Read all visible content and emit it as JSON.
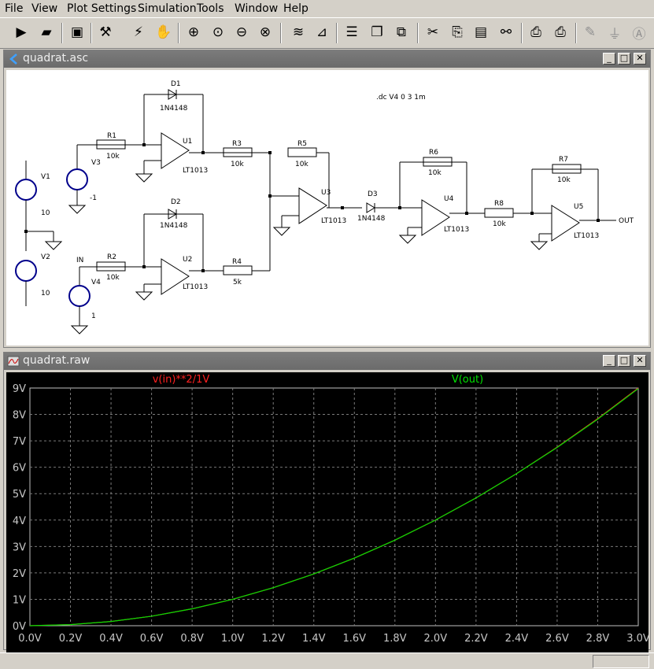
{
  "menu": {
    "file": "File",
    "view": "View",
    "plot_settings": "Plot Settings",
    "simulation": "Simulation",
    "tools": "Tools",
    "window": "Window",
    "help": "Help"
  },
  "schematic_window": {
    "title": "quadrat.asc",
    "directive": ".dc V4 0 3 1m",
    "components": {
      "D1": {
        "name": "D1",
        "model": "1N4148"
      },
      "D2": {
        "name": "D2",
        "model": "1N4148"
      },
      "D3": {
        "name": "D3",
        "model": "1N4148"
      },
      "R1": {
        "name": "R1",
        "value": "10k"
      },
      "R2": {
        "name": "R2",
        "value": "10k"
      },
      "R3": {
        "name": "R3",
        "value": "10k"
      },
      "R4": {
        "name": "R4",
        "value": "5k"
      },
      "R5": {
        "name": "R5",
        "value": "10k"
      },
      "R6": {
        "name": "R6",
        "value": "10k"
      },
      "R7": {
        "name": "R7",
        "value": "10k"
      },
      "R8": {
        "name": "R8",
        "value": "10k"
      },
      "U1": {
        "name": "U1",
        "model": "LT1013"
      },
      "U2": {
        "name": "U2",
        "model": "LT1013"
      },
      "U3": {
        "name": "U3",
        "model": "LT1013"
      },
      "U4": {
        "name": "U4",
        "model": "LT1013"
      },
      "U5": {
        "name": "U5",
        "model": "LT1013"
      },
      "V1": {
        "name": "V1",
        "value": "10"
      },
      "V2": {
        "name": "V2",
        "value": "10"
      },
      "V3": {
        "name": "V3",
        "value": "-1"
      },
      "V4": {
        "name": "V4",
        "value": "1"
      }
    },
    "net_in": "IN",
    "net_out": "OUT"
  },
  "plot_window": {
    "title": "quadrat.raw"
  },
  "chart_data": {
    "type": "line",
    "title": "",
    "xlabel": "",
    "ylabel": "",
    "xlim": [
      0,
      3
    ],
    "ylim": [
      0,
      9
    ],
    "x_ticks": [
      "0.0V",
      "0.2V",
      "0.4V",
      "0.6V",
      "0.8V",
      "1.0V",
      "1.2V",
      "1.4V",
      "1.6V",
      "1.8V",
      "2.0V",
      "2.2V",
      "2.4V",
      "2.6V",
      "2.8V",
      "3.0V"
    ],
    "y_ticks": [
      "0V",
      "1V",
      "2V",
      "3V",
      "4V",
      "5V",
      "6V",
      "7V",
      "8V",
      "9V"
    ],
    "grid": true,
    "background": "#000000",
    "x": [
      0,
      0.2,
      0.4,
      0.6,
      0.8,
      1.0,
      1.2,
      1.4,
      1.6,
      1.8,
      2.0,
      2.2,
      2.4,
      2.6,
      2.8,
      3.0
    ],
    "series": [
      {
        "name": "v(in)**2/1V",
        "color": "#ff2020",
        "values": [
          0,
          0.04,
          0.16,
          0.36,
          0.64,
          1.0,
          1.44,
          1.96,
          2.56,
          3.24,
          4.0,
          4.84,
          5.76,
          6.76,
          7.84,
          9.0
        ]
      },
      {
        "name": "V(out)",
        "color": "#00e000",
        "values": [
          0,
          0.04,
          0.16,
          0.36,
          0.64,
          1.0,
          1.44,
          1.96,
          2.56,
          3.24,
          4.0,
          4.84,
          5.76,
          6.75,
          7.82,
          8.98
        ]
      }
    ]
  }
}
